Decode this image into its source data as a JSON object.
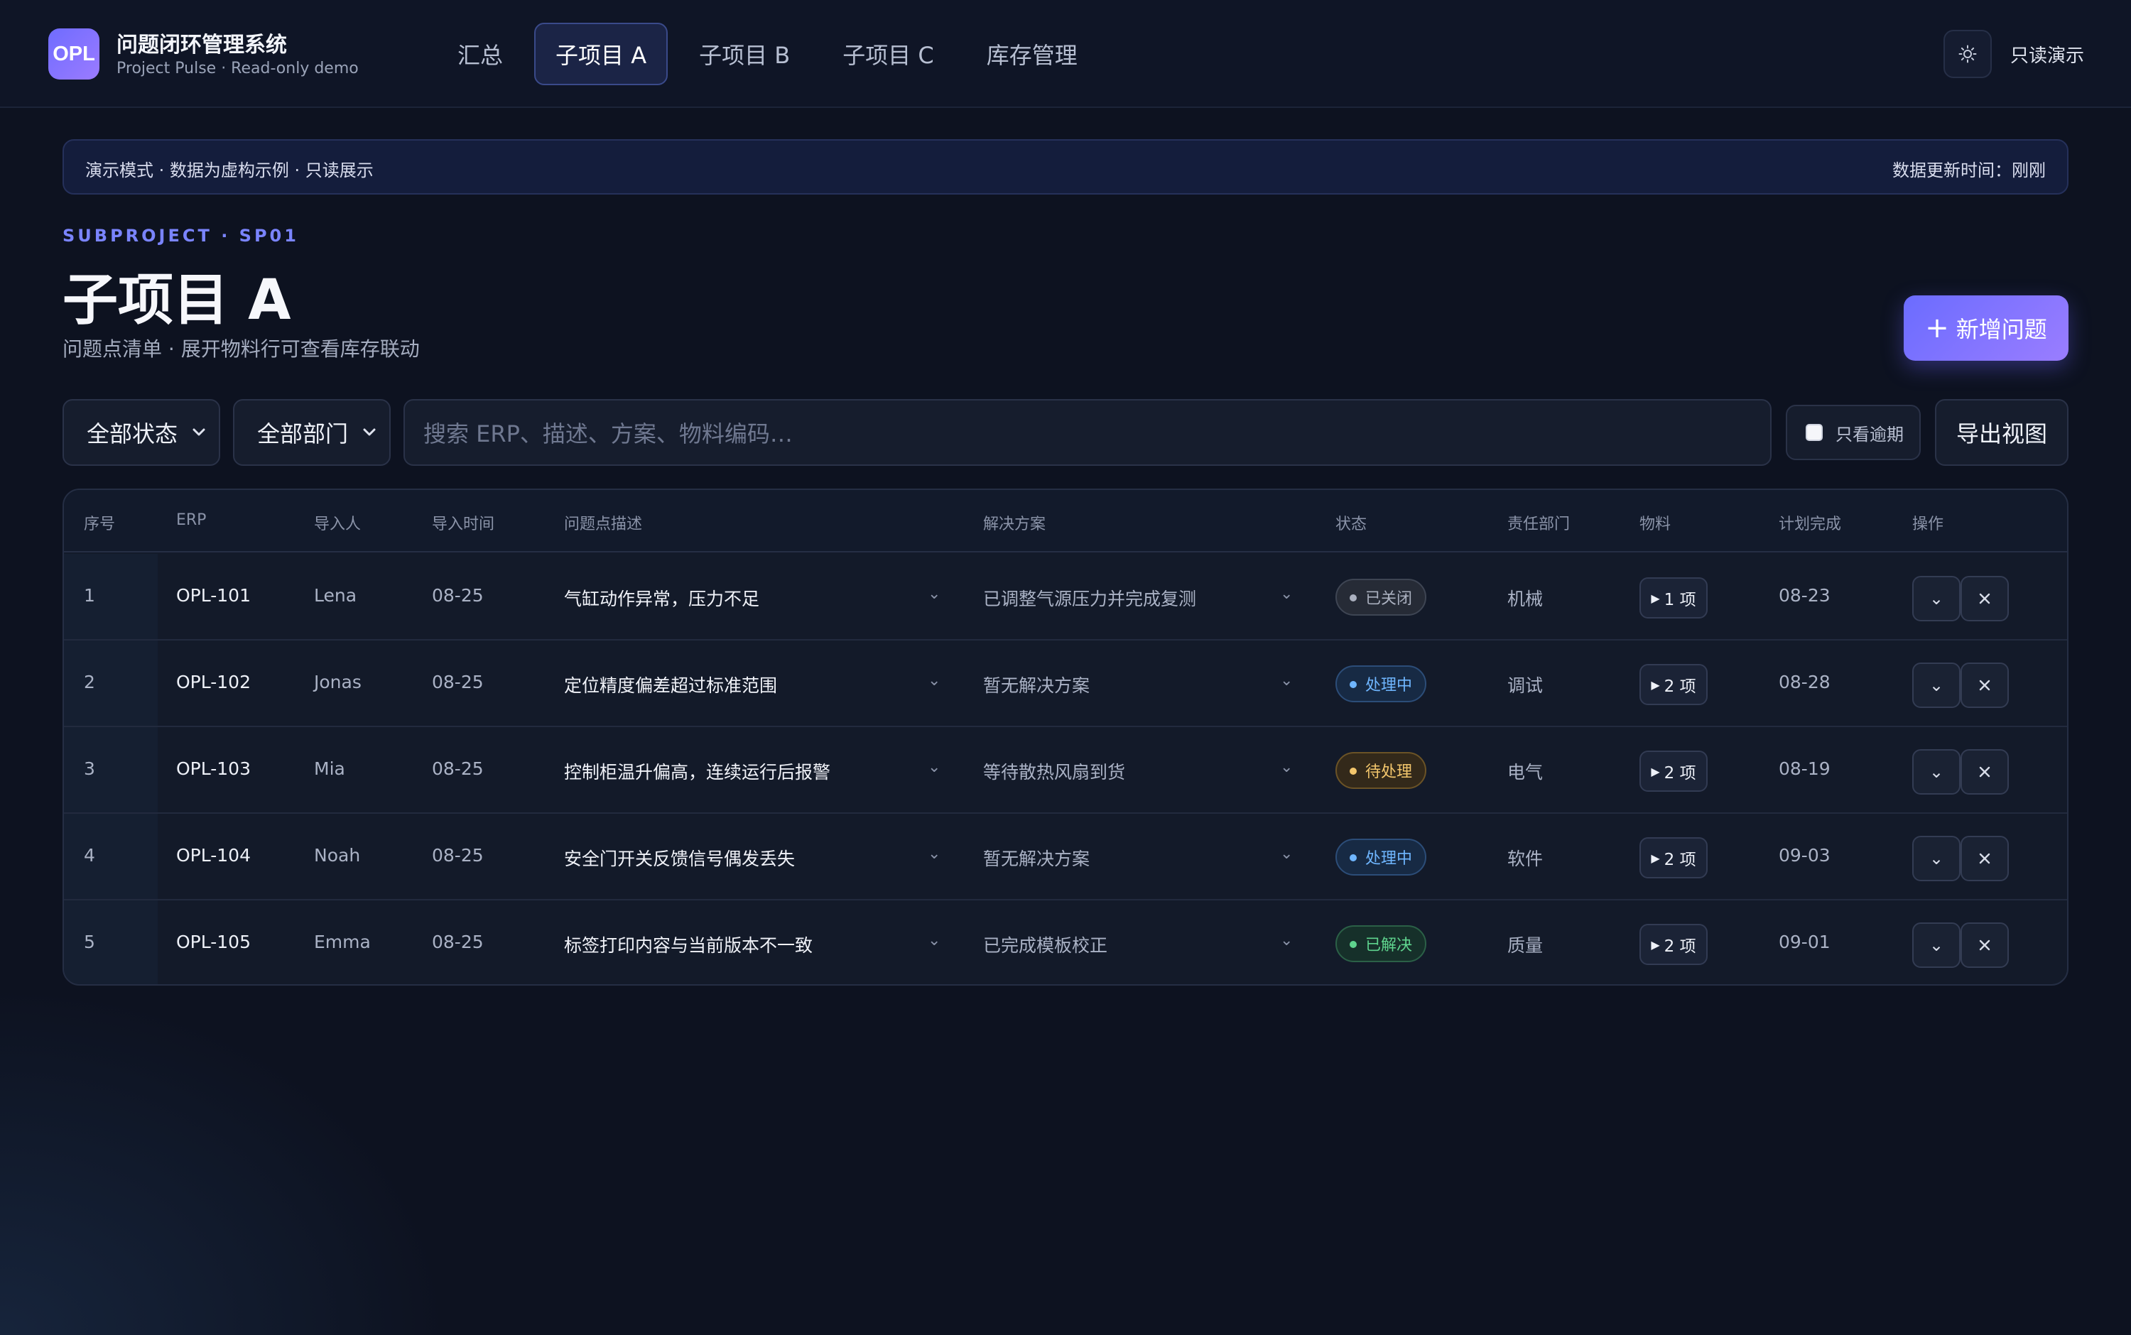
{
  "app": {
    "logo": "OPL",
    "title": "问题闭环管理系统",
    "subtitle": "Project Pulse · Read-only demo",
    "readonly_label": "只读演示"
  },
  "nav": {
    "tabs": [
      {
        "label": "汇总"
      },
      {
        "label": "子项目 A"
      },
      {
        "label": "子项目 B"
      },
      {
        "label": "子项目 C"
      },
      {
        "label": "库存管理"
      }
    ],
    "active_index": 1
  },
  "banner": {
    "left": "演示模式 · 数据为虚构示例 · 只读展示",
    "right": "数据更新时间：刚刚"
  },
  "header": {
    "eyebrow": "SUBPROJECT · SP01",
    "title": "子项目 A",
    "subtitle": "问题点清单 · 展开物料行可查看库存联动",
    "new_button": "新增问题"
  },
  "filters": {
    "status": "全部状态",
    "department": "全部部门",
    "search_placeholder": "搜索 ERP、描述、方案、物料编码…",
    "overdue_label": "只看逾期",
    "export_label": "导出视图"
  },
  "table": {
    "columns": [
      "序号",
      "ERP",
      "导入人",
      "导入时间",
      "问题点描述",
      "解决方案",
      "状态",
      "责任部门",
      "物料",
      "计划完成",
      "操作"
    ],
    "rows": [
      {
        "no": "1",
        "erp": "OPL-101",
        "importer": "Lena",
        "date": "08-25",
        "desc": "气缸动作异常，压力不足",
        "solution": "已调整气源压力并完成复测",
        "status": "已关闭",
        "status_type": "closed",
        "dept": "机械",
        "material": "1 项",
        "due": "08-23"
      },
      {
        "no": "2",
        "erp": "OPL-102",
        "importer": "Jonas",
        "date": "08-25",
        "desc": "定位精度偏差超过标准范围",
        "solution": "暂无解决方案",
        "status": "处理中",
        "status_type": "prog",
        "dept": "调试",
        "material": "2 项",
        "due": "08-28"
      },
      {
        "no": "3",
        "erp": "OPL-103",
        "importer": "Mia",
        "date": "08-25",
        "desc": "控制柜温升偏高，连续运行后报警",
        "solution": "等待散热风扇到货",
        "status": "待处理",
        "status_type": "pend",
        "dept": "电气",
        "material": "2 项",
        "due": "08-19"
      },
      {
        "no": "4",
        "erp": "OPL-104",
        "importer": "Noah",
        "date": "08-25",
        "desc": "安全门开关反馈信号偶发丢失",
        "solution": "暂无解决方案",
        "status": "处理中",
        "status_type": "prog",
        "dept": "软件",
        "material": "2 项",
        "due": "09-03"
      },
      {
        "no": "5",
        "erp": "OPL-105",
        "importer": "Emma",
        "date": "08-25",
        "desc": "标签打印内容与当前版本不一致",
        "solution": "已完成模板校正",
        "status": "已解决",
        "status_type": "solved",
        "dept": "质量",
        "material": "2 项",
        "due": "09-01"
      }
    ]
  },
  "colors": {
    "accent": "#6f6cff",
    "background": "#0d1220",
    "status_closed": "#aab0bf",
    "status_in_progress": "#6fb6ff",
    "status_pending": "#f3c66c",
    "status_solved": "#5fd48e"
  },
  "icons": {
    "theme": "sun-icon",
    "add": "plus-icon",
    "select": "chevron-down-icon",
    "material": "triangle-right-icon",
    "expand": "chevron-down-icon",
    "delete": "close-icon"
  }
}
